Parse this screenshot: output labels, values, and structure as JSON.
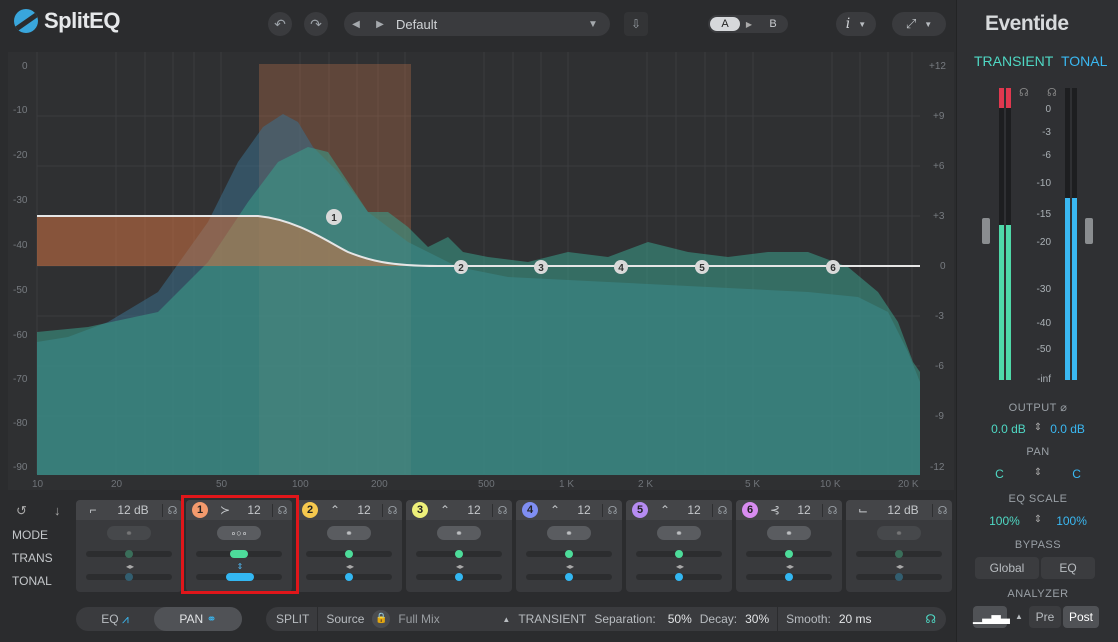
{
  "app": {
    "name": "SplitEQ",
    "brand": "Eventide"
  },
  "header": {
    "undo_icon": "undo-icon",
    "redo_icon": "redo-icon",
    "preset_name": "Default",
    "ab": {
      "a": "A",
      "b": "B",
      "active": "A"
    },
    "info_label": "i"
  },
  "graph": {
    "db_left": [
      "0",
      "-10",
      "-20",
      "-30",
      "-40",
      "-50",
      "-60",
      "-70",
      "-80",
      "-90"
    ],
    "db_right": [
      "+12",
      "+9",
      "+6",
      "+3",
      "0",
      "-3",
      "-6",
      "-9",
      "-12"
    ],
    "freq_labels": [
      "10",
      "20",
      "50",
      "100",
      "200",
      "500",
      "1 K",
      "2 K",
      "5 K",
      "10 K",
      "20 K"
    ],
    "nodes": [
      "1",
      "2",
      "3",
      "4",
      "5",
      "6"
    ]
  },
  "bands": {
    "row_labels": {
      "mode": "MODE",
      "trans": "TRANS",
      "tonal": "TONAL"
    },
    "low_shelf": {
      "value": "12 dB"
    },
    "high_shelf": {
      "value": "12 dB"
    },
    "items": [
      {
        "num": "1",
        "value": "12",
        "color": "#f39a6d"
      },
      {
        "num": "2",
        "value": "12",
        "color": "#f6c94e"
      },
      {
        "num": "3",
        "value": "12",
        "color": "#eef07a"
      },
      {
        "num": "4",
        "value": "12",
        "color": "#7f8ef2"
      },
      {
        "num": "5",
        "value": "12",
        "color": "#b68cf2"
      },
      {
        "num": "6",
        "value": "12",
        "color": "#d88cf0"
      }
    ]
  },
  "bottom": {
    "eq_label": "EQ",
    "pan_label": "PAN",
    "split_label": "SPLIT",
    "source_label": "Source",
    "source_value": "Full Mix",
    "transient_label": "TRANSIENT",
    "separation_label": "Separation:",
    "separation_value": "50%",
    "decay_label": "Decay:",
    "decay_value": "30%",
    "smooth_label": "Smooth:",
    "smooth_value": "20 ms"
  },
  "right": {
    "tab_transient": "TRANSIENT",
    "tab_tonal": "TONAL",
    "meter_scale": [
      "0",
      "-3",
      "-6",
      "-10",
      "-15",
      "-20",
      "-30",
      "-40",
      "-50",
      "-inf"
    ],
    "output_label": "OUTPUT",
    "output_left": "0.0 dB",
    "output_right": "0.0 dB",
    "pan_label": "PAN",
    "pan_left": "C",
    "pan_right": "C",
    "eqscale_label": "EQ SCALE",
    "eqscale_left": "100%",
    "eqscale_right": "100%",
    "bypass_label": "BYPASS",
    "bypass_global": "Global",
    "bypass_eq": "EQ",
    "analyzer_label": "ANALYZER",
    "analyzer_pre": "Pre",
    "analyzer_post": "Post"
  },
  "colors": {
    "transient": "#4fd8c4",
    "tonal": "#3ab8f2",
    "highlight": "#e0161a"
  }
}
